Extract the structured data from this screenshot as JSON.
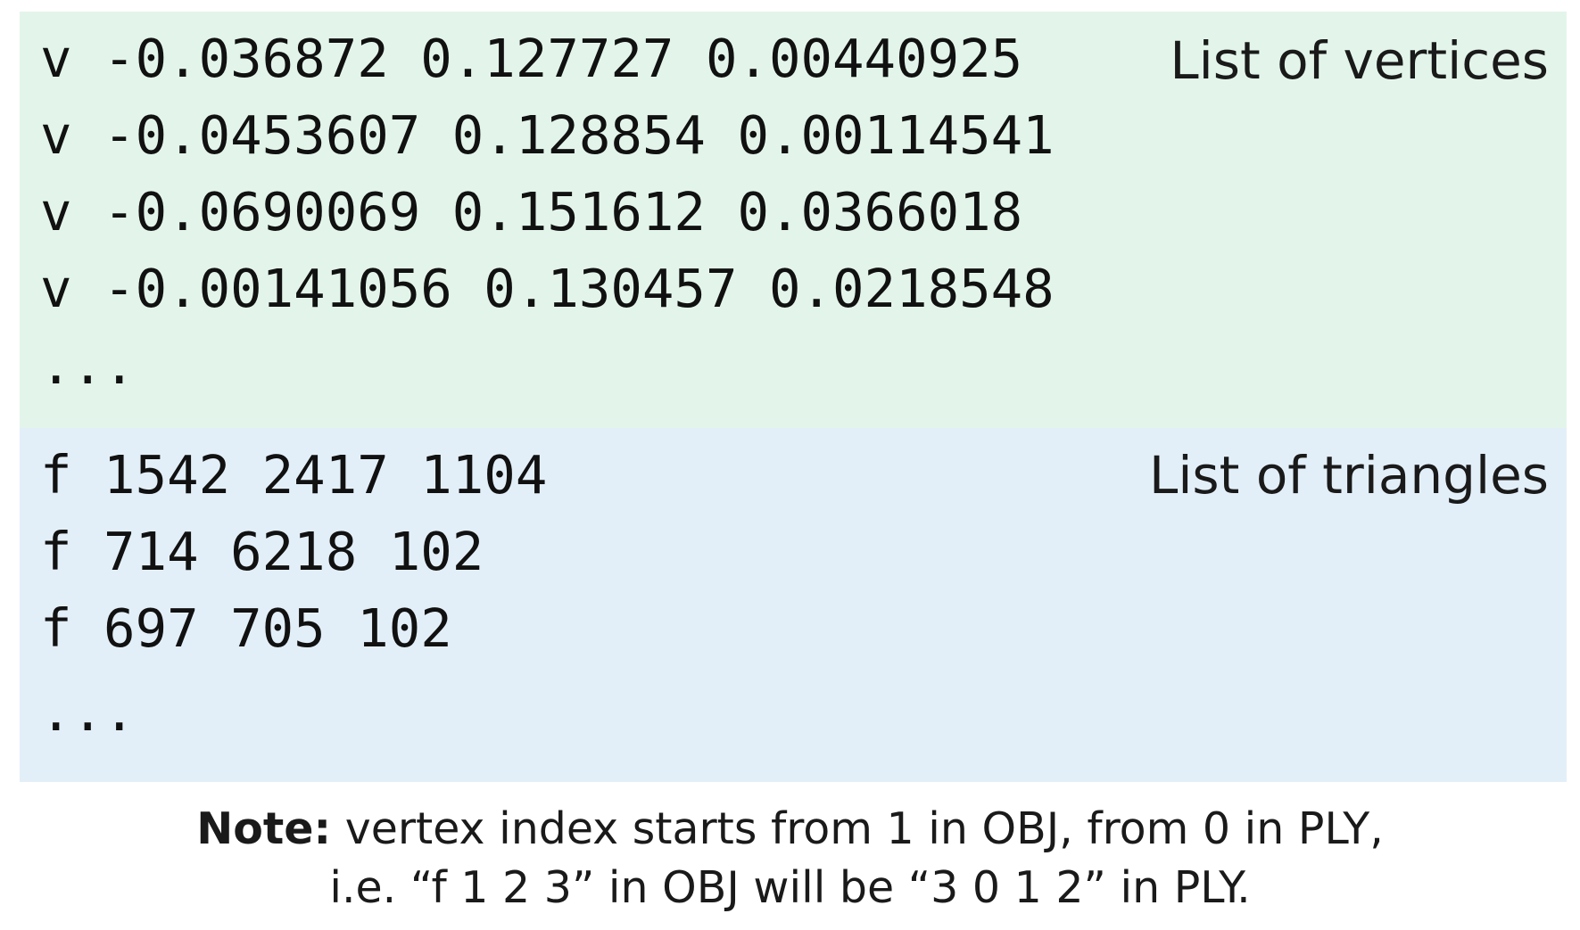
{
  "vertices": {
    "label": "List of vertices",
    "lines": [
      "v -0.036872 0.127727 0.00440925",
      "v -0.0453607 0.128854 0.00114541",
      "v -0.0690069 0.151612 0.0366018",
      "v -0.00141056 0.130457 0.0218548",
      "..."
    ],
    "color": "#e3f5ea"
  },
  "triangles": {
    "label": "List of triangles",
    "lines": [
      "f 1542 2417 1104",
      "f 714 6218 102",
      "f 697 705 102",
      "..."
    ],
    "color": "#e3eff8"
  },
  "note": {
    "bold": "Note:",
    "line1": " vertex index starts from 1 in OBJ, from 0 in PLY,",
    "line2": "i.e. “f 1 2 3” in OBJ will be “3 0 1 2” in PLY."
  }
}
